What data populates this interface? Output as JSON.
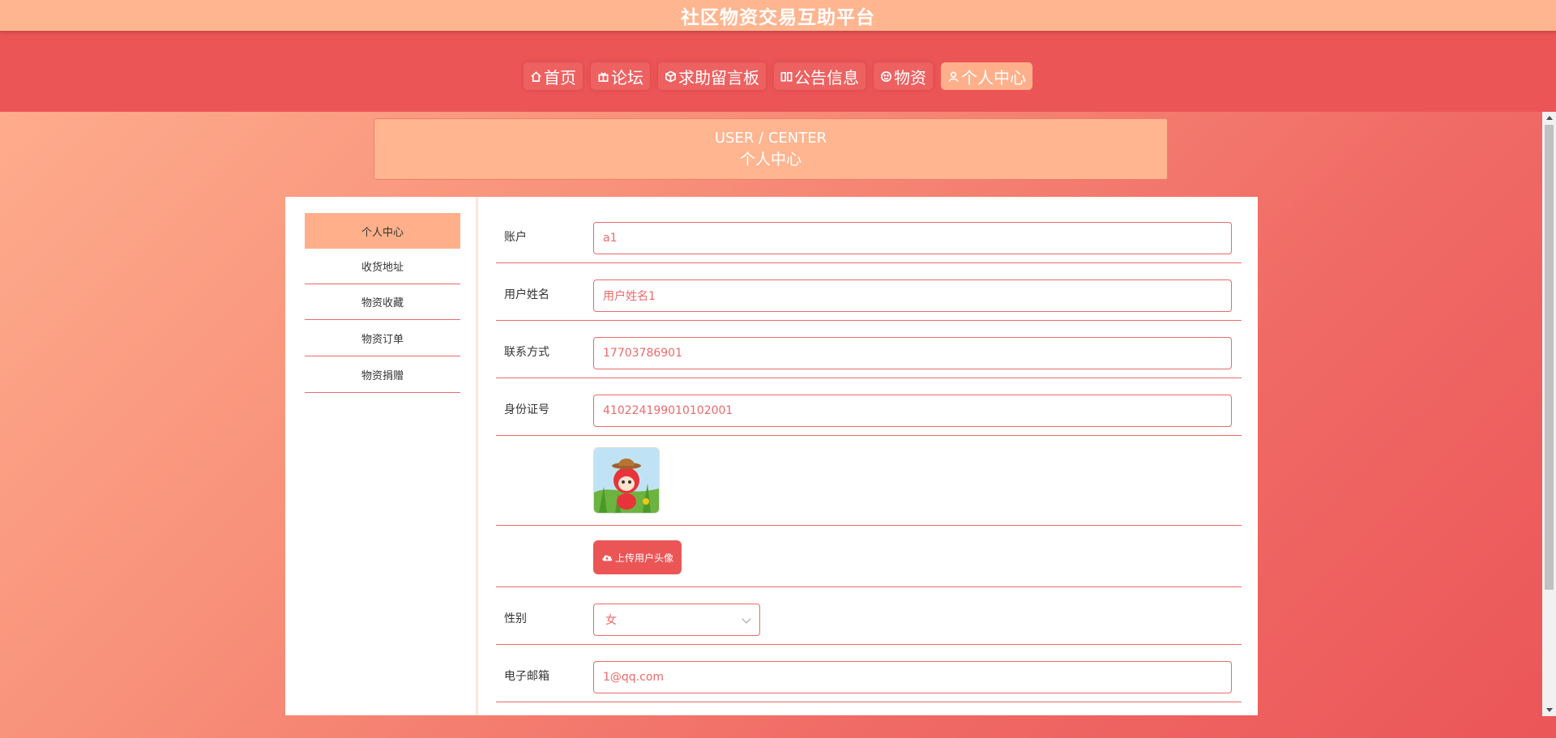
{
  "site": {
    "title": "社区物资交易互助平台"
  },
  "nav": [
    {
      "label": "首页",
      "icon": "home-icon"
    },
    {
      "label": "论坛",
      "icon": "gift-icon"
    },
    {
      "label": "求助留言板",
      "icon": "box-icon"
    },
    {
      "label": "公告信息",
      "icon": "book-icon"
    },
    {
      "label": "物资",
      "icon": "smile-icon"
    },
    {
      "label": "个人中心",
      "icon": "user-icon",
      "active": true
    }
  ],
  "banner": {
    "en": "USER / CENTER",
    "cn": "个人中心"
  },
  "sidebar": [
    {
      "label": "个人中心",
      "active": true
    },
    {
      "label": "收货地址"
    },
    {
      "label": "物资收藏"
    },
    {
      "label": "物资订单"
    },
    {
      "label": "物资捐赠"
    }
  ],
  "form": {
    "account": {
      "label": "账户",
      "value": "a1"
    },
    "name": {
      "label": "用户姓名",
      "value": "用户姓名1"
    },
    "phone": {
      "label": "联系方式",
      "value": "17703786901"
    },
    "idcard": {
      "label": "身份证号",
      "value": "410224199010102001"
    },
    "upload_label": "上传用户头像",
    "gender": {
      "label": "性别",
      "value": "女"
    },
    "email": {
      "label": "电子邮箱",
      "value": "1@qq.com"
    }
  },
  "colors": {
    "accent": "#ec5556",
    "peach": "#ffb590",
    "line": "#ec6a6a"
  }
}
